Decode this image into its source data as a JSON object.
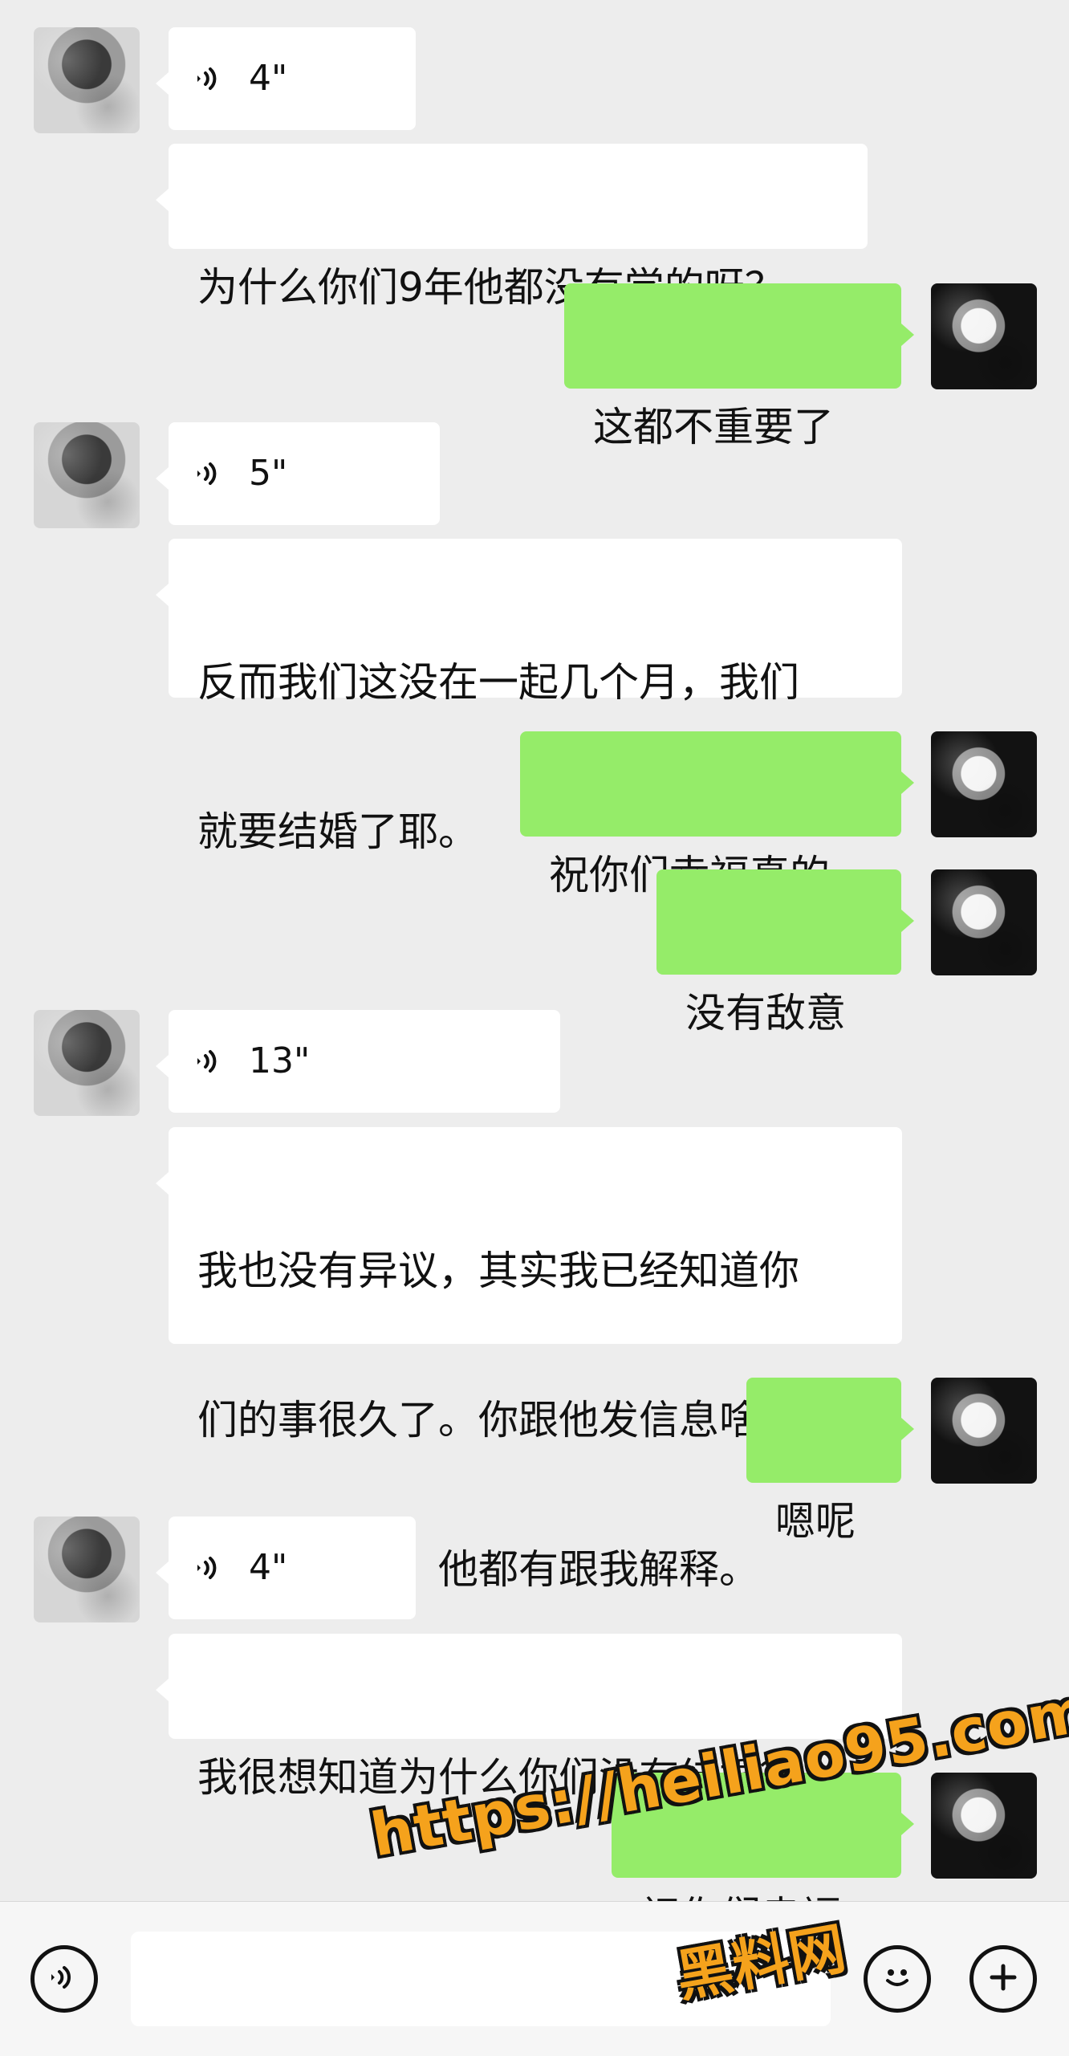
{
  "messages": [
    {
      "type": "voice",
      "side": "left",
      "duration": "4\""
    },
    {
      "type": "text",
      "side": "left",
      "lines": [
        "为什么你们9年他都没有学的呀？"
      ]
    },
    {
      "type": "text",
      "side": "right",
      "lines": [
        "这都不重要了"
      ]
    },
    {
      "type": "voice",
      "side": "left",
      "duration": "5\""
    },
    {
      "type": "text",
      "side": "left",
      "lines": [
        "反而我们这没在一起几个月，我们",
        "就要结婚了耶。"
      ]
    },
    {
      "type": "text",
      "side": "right",
      "lines": [
        "祝你们幸福真的"
      ]
    },
    {
      "type": "text",
      "side": "right",
      "lines": [
        "没有敌意"
      ]
    },
    {
      "type": "voice",
      "side": "left",
      "duration": "13\""
    },
    {
      "type": "text",
      "side": "left",
      "lines": [
        "我也没有异议，其实我已经知道你",
        "们的事很久了。你跟他发信息啥的，",
        "我都有看见，他都有跟我解释。"
      ]
    },
    {
      "type": "text",
      "side": "right",
      "lines": [
        "嗯呢"
      ]
    },
    {
      "type": "voice",
      "side": "left",
      "duration": "4\""
    },
    {
      "type": "text",
      "side": "left",
      "lines": [
        "我很想知道为什么你们没有结婚？"
      ]
    },
    {
      "type": "text",
      "side": "right",
      "lines": [
        "祝你们幸福"
      ]
    }
  ],
  "input_bar": {
    "value": "",
    "placeholder": ""
  },
  "watermark": {
    "url": "https://heiliao95.com",
    "brand": "黑料网"
  },
  "icons": {
    "voice_message": "sound-wave-icon",
    "voice_toggle": "voice-toggle-icon",
    "emoji": "emoji-icon",
    "plus": "plus-icon"
  },
  "colors": {
    "background": "#ededed",
    "incoming_bubble": "#ffffff",
    "outgoing_bubble": "#95ec69",
    "watermark": "#f5a21c"
  }
}
